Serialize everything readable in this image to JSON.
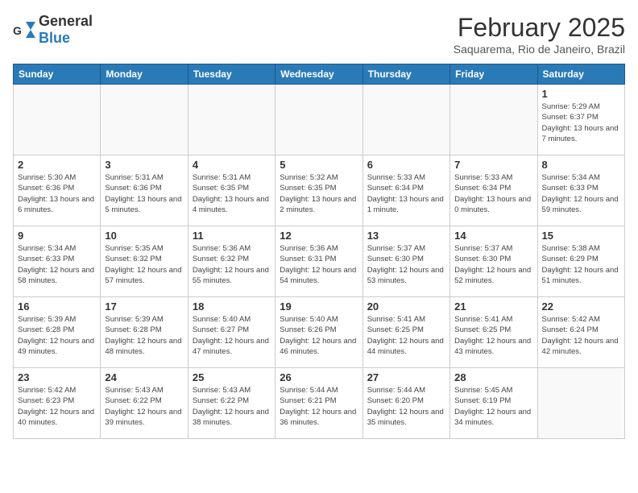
{
  "header": {
    "logo_general": "General",
    "logo_blue": "Blue",
    "month_title": "February 2025",
    "location": "Saquarema, Rio de Janeiro, Brazil"
  },
  "weekdays": [
    "Sunday",
    "Monday",
    "Tuesday",
    "Wednesday",
    "Thursday",
    "Friday",
    "Saturday"
  ],
  "weeks": [
    [
      {
        "day": "",
        "info": ""
      },
      {
        "day": "",
        "info": ""
      },
      {
        "day": "",
        "info": ""
      },
      {
        "day": "",
        "info": ""
      },
      {
        "day": "",
        "info": ""
      },
      {
        "day": "",
        "info": ""
      },
      {
        "day": "1",
        "info": "Sunrise: 5:29 AM\nSunset: 6:37 PM\nDaylight: 13 hours and 7 minutes."
      }
    ],
    [
      {
        "day": "2",
        "info": "Sunrise: 5:30 AM\nSunset: 6:36 PM\nDaylight: 13 hours and 6 minutes."
      },
      {
        "day": "3",
        "info": "Sunrise: 5:31 AM\nSunset: 6:36 PM\nDaylight: 13 hours and 5 minutes."
      },
      {
        "day": "4",
        "info": "Sunrise: 5:31 AM\nSunset: 6:35 PM\nDaylight: 13 hours and 4 minutes."
      },
      {
        "day": "5",
        "info": "Sunrise: 5:32 AM\nSunset: 6:35 PM\nDaylight: 13 hours and 2 minutes."
      },
      {
        "day": "6",
        "info": "Sunrise: 5:33 AM\nSunset: 6:34 PM\nDaylight: 13 hours and 1 minute."
      },
      {
        "day": "7",
        "info": "Sunrise: 5:33 AM\nSunset: 6:34 PM\nDaylight: 13 hours and 0 minutes."
      },
      {
        "day": "8",
        "info": "Sunrise: 5:34 AM\nSunset: 6:33 PM\nDaylight: 12 hours and 59 minutes."
      }
    ],
    [
      {
        "day": "9",
        "info": "Sunrise: 5:34 AM\nSunset: 6:33 PM\nDaylight: 12 hours and 58 minutes."
      },
      {
        "day": "10",
        "info": "Sunrise: 5:35 AM\nSunset: 6:32 PM\nDaylight: 12 hours and 57 minutes."
      },
      {
        "day": "11",
        "info": "Sunrise: 5:36 AM\nSunset: 6:32 PM\nDaylight: 12 hours and 55 minutes."
      },
      {
        "day": "12",
        "info": "Sunrise: 5:36 AM\nSunset: 6:31 PM\nDaylight: 12 hours and 54 minutes."
      },
      {
        "day": "13",
        "info": "Sunrise: 5:37 AM\nSunset: 6:30 PM\nDaylight: 12 hours and 53 minutes."
      },
      {
        "day": "14",
        "info": "Sunrise: 5:37 AM\nSunset: 6:30 PM\nDaylight: 12 hours and 52 minutes."
      },
      {
        "day": "15",
        "info": "Sunrise: 5:38 AM\nSunset: 6:29 PM\nDaylight: 12 hours and 51 minutes."
      }
    ],
    [
      {
        "day": "16",
        "info": "Sunrise: 5:39 AM\nSunset: 6:28 PM\nDaylight: 12 hours and 49 minutes."
      },
      {
        "day": "17",
        "info": "Sunrise: 5:39 AM\nSunset: 6:28 PM\nDaylight: 12 hours and 48 minutes."
      },
      {
        "day": "18",
        "info": "Sunrise: 5:40 AM\nSunset: 6:27 PM\nDaylight: 12 hours and 47 minutes."
      },
      {
        "day": "19",
        "info": "Sunrise: 5:40 AM\nSunset: 6:26 PM\nDaylight: 12 hours and 46 minutes."
      },
      {
        "day": "20",
        "info": "Sunrise: 5:41 AM\nSunset: 6:25 PM\nDaylight: 12 hours and 44 minutes."
      },
      {
        "day": "21",
        "info": "Sunrise: 5:41 AM\nSunset: 6:25 PM\nDaylight: 12 hours and 43 minutes."
      },
      {
        "day": "22",
        "info": "Sunrise: 5:42 AM\nSunset: 6:24 PM\nDaylight: 12 hours and 42 minutes."
      }
    ],
    [
      {
        "day": "23",
        "info": "Sunrise: 5:42 AM\nSunset: 6:23 PM\nDaylight: 12 hours and 40 minutes."
      },
      {
        "day": "24",
        "info": "Sunrise: 5:43 AM\nSunset: 6:22 PM\nDaylight: 12 hours and 39 minutes."
      },
      {
        "day": "25",
        "info": "Sunrise: 5:43 AM\nSunset: 6:22 PM\nDaylight: 12 hours and 38 minutes."
      },
      {
        "day": "26",
        "info": "Sunrise: 5:44 AM\nSunset: 6:21 PM\nDaylight: 12 hours and 36 minutes."
      },
      {
        "day": "27",
        "info": "Sunrise: 5:44 AM\nSunset: 6:20 PM\nDaylight: 12 hours and 35 minutes."
      },
      {
        "day": "28",
        "info": "Sunrise: 5:45 AM\nSunset: 6:19 PM\nDaylight: 12 hours and 34 minutes."
      },
      {
        "day": "",
        "info": ""
      }
    ]
  ]
}
